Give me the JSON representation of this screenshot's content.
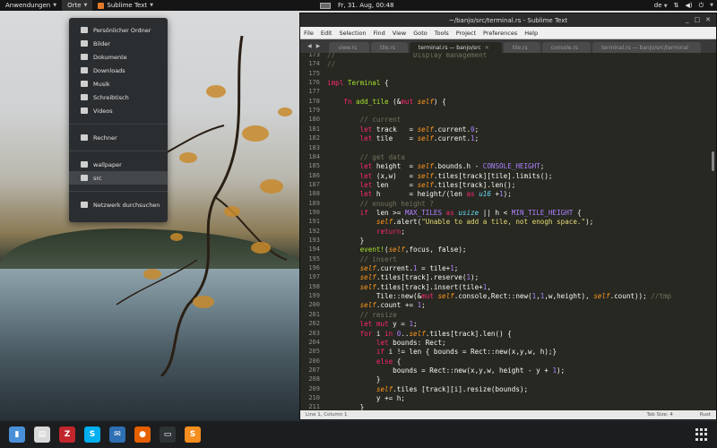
{
  "topbar": {
    "activities": "Anwendungen",
    "places": "Orte",
    "app_name": "Sublime Text",
    "clock": "Fr, 31. Aug, 00:48",
    "keyboard_layout": "de"
  },
  "places_menu": {
    "items": [
      {
        "label": "Persönlicher Ordner",
        "icon": "home-icon"
      },
      {
        "label": "Bilder",
        "icon": "pictures-icon"
      },
      {
        "label": "Dokumente",
        "icon": "documents-icon"
      },
      {
        "label": "Downloads",
        "icon": "downloads-icon"
      },
      {
        "label": "Musik",
        "icon": "music-icon"
      },
      {
        "label": "Schreibtisch",
        "icon": "desktop-icon"
      },
      {
        "label": "Videos",
        "icon": "videos-icon"
      },
      {
        "label": "Rechner",
        "icon": "computer-icon"
      },
      {
        "label": "wallpaper",
        "icon": "folder-icon"
      },
      {
        "label": "src",
        "icon": "folder-icon"
      },
      {
        "label": "Netzwerk durchsuchen",
        "icon": "network-icon"
      }
    ]
  },
  "window": {
    "title": "~/banjo/src/terminal.rs - Sublime Text",
    "menu": [
      "File",
      "Edit",
      "Selection",
      "Find",
      "View",
      "Goto",
      "Tools",
      "Project",
      "Preferences",
      "Help"
    ],
    "tabs": [
      {
        "label": "view.rs",
        "active": false
      },
      {
        "label": "tile.rs",
        "active": false
      },
      {
        "label": "terminal.rs — banjo/src",
        "active": true
      },
      {
        "label": "tile.rs",
        "active": false
      },
      {
        "label": "console.rs",
        "active": false
      },
      {
        "label": "terminal.rs — banjo/src/terminal",
        "active": false
      }
    ]
  },
  "editor": {
    "line_numbers": [
      "173",
      "174",
      "175",
      "176",
      "177",
      "178",
      "179",
      "180",
      "181",
      "182",
      "183",
      "184",
      "185",
      "186",
      "187",
      "188",
      "189",
      "190",
      "191",
      "192",
      "193",
      "194",
      "195",
      "196",
      "197",
      "198",
      "199",
      "200",
      "201",
      "202",
      "203",
      "204",
      "205",
      "206",
      "207",
      "208",
      "209",
      "210",
      "211"
    ],
    "lines": [
      "//                   Display management",
      "//",
      "",
      "impl Terminal {",
      "",
      "    fn add_tile (&mut self) {",
      "",
      "        // current",
      "        let track   = self.current.0;",
      "        let tile    = self.current.1;",
      "",
      "        // get data",
      "        let height  = self.bounds.h - CONSOLE_HEIGHT;",
      "        let (x,w)   = self.tiles[track][tile].limits();",
      "        let len     = self.tiles[track].len();",
      "        let h       = height/(len as u16 +1);",
      "        // enough height ?",
      "        if  len >= MAX_TILES as usize || h < MIN_TILE_HEIGHT {",
      "            self.alert(\"Unable to add a tile, not enogh space.\");",
      "            return;",
      "        }",
      "        event!(self,focus, false);",
      "        // insert",
      "        self.current.1 = tile+1;",
      "        self.tiles[track].reserve(1);",
      "        self.tiles[track].insert(tile+1,",
      "            Tile::new(&mut self.console,Rect::new(1,1,w,height), self.count)); //tmp",
      "        self.count += 1;",
      "        // resize",
      "        let mut y = 1;",
      "        for i in 0..self.tiles[track].len() {",
      "            let bounds: Rect;",
      "            if i != len { bounds = Rect::new(x,y,w, h);}",
      "            else {",
      "                bounds = Rect::new(x,y,w, height - y + 1);",
      "            }",
      "            self.tiles [track][i].resize(bounds);",
      "            y += h;",
      "        }"
    ]
  },
  "statusbar": {
    "position": "Line 1, Column 1",
    "tab_size": "Tab Size: 4",
    "syntax": "Rust"
  },
  "taskbar": {
    "apps": [
      {
        "name": "files",
        "icon": "file-manager-icon",
        "color": "#4a90d9"
      },
      {
        "name": "archive",
        "icon": "archive-icon",
        "color": "#d8d8d8"
      },
      {
        "name": "filezilla",
        "icon": "filezilla-icon",
        "color": "#c1272d"
      },
      {
        "name": "skype",
        "icon": "skype-icon",
        "color": "#00aff0"
      },
      {
        "name": "thunderbird",
        "icon": "thunderbird-icon",
        "color": "#2f6fb3"
      },
      {
        "name": "firefox",
        "icon": "firefox-icon",
        "color": "#e66000"
      },
      {
        "name": "terminal",
        "icon": "terminal-icon",
        "color": "#2e3436"
      },
      {
        "name": "sublime",
        "icon": "sublime-icon",
        "color": "#f58d1f"
      }
    ]
  },
  "colors": {
    "editor_bg": "#272822",
    "keyword": "#f92672",
    "type": "#66d9ef",
    "function": "#a6e22e",
    "string": "#e6db74",
    "number": "#ae81ff",
    "comment": "#75715e"
  }
}
